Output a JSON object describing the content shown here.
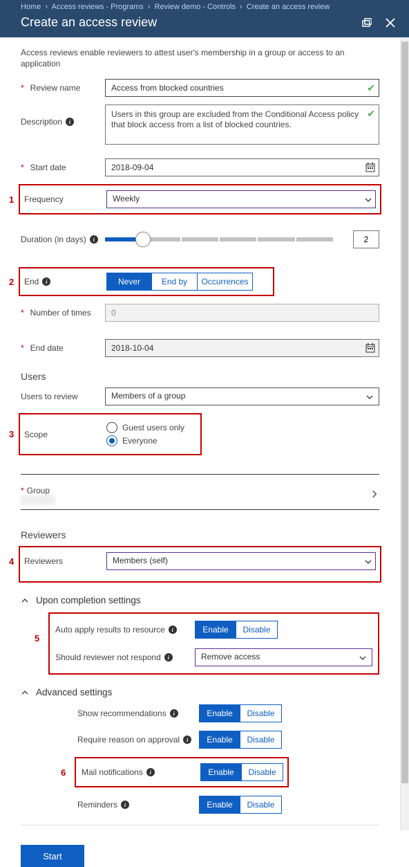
{
  "breadcrumbs": [
    "Home",
    "Access reviews - Programs",
    "Review demo - Controls",
    "Create an access review"
  ],
  "title": "Create an access review",
  "intro": "Access reviews enable reviewers to attest user's membership in a group or access to an application",
  "labels": {
    "reviewName": "Review name",
    "description": "Description",
    "startDate": "Start date",
    "frequency": "Frequency",
    "duration": "Duration (in days)",
    "end": "End",
    "numTimes": "Number of times",
    "endDate": "End date",
    "usersSection": "Users",
    "usersToReview": "Users to review",
    "scope": "Scope",
    "group": "Group",
    "reviewersSection": "Reviewers",
    "reviewers": "Reviewers",
    "uponCompletion": "Upon completion settings",
    "autoApply": "Auto apply results to resource",
    "notRespond": "Should reviewer not respond",
    "advanced": "Advanced settings",
    "showRec": "Show recommendations",
    "requireReason": "Require reason on approval",
    "mailNotif": "Mail notifications",
    "reminders": "Reminders"
  },
  "values": {
    "reviewName": "Access from blocked countries",
    "description": "Users in this group are excluded from the Conditional Access policy that block access from a list of blocked countries.",
    "startDate": "2018-09-04",
    "frequency": "Weekly",
    "durationDays": "2",
    "numTimes": "0",
    "endDate": "2018-10-04",
    "usersToReview": "Members of a group",
    "reviewers": "Members (self)",
    "notRespond": "Remove access"
  },
  "endOptions": {
    "never": "Never",
    "endBy": "End by",
    "occurrences": "Occurrences"
  },
  "scopeOptions": {
    "guest": "Guest users only",
    "everyone": "Everyone"
  },
  "toggle": {
    "enable": "Enable",
    "disable": "Disable"
  },
  "markers": {
    "m1": "1",
    "m2": "2",
    "m3": "3",
    "m4": "4",
    "m5": "5",
    "m6": "6"
  },
  "startBtn": "Start"
}
